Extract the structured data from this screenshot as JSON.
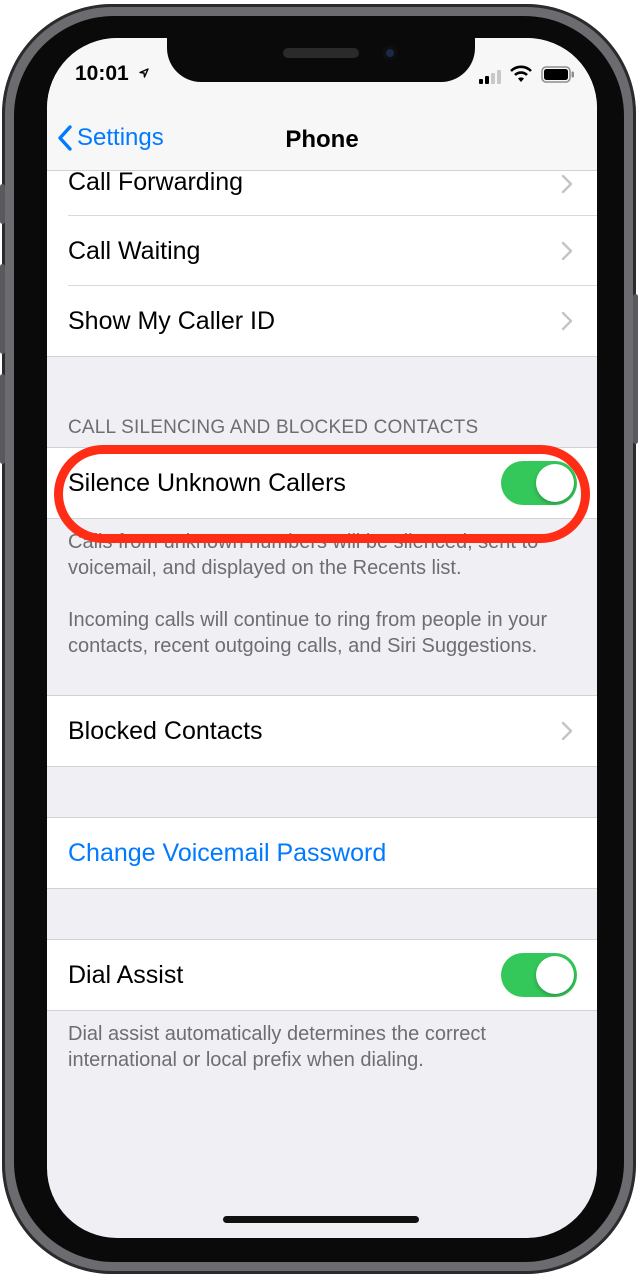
{
  "status_bar": {
    "time": "10:01",
    "icons": [
      "location-arrow-icon",
      "cellular-signal-icon",
      "wifi-icon",
      "battery-icon"
    ]
  },
  "nav": {
    "back_label": "Settings",
    "title": "Phone"
  },
  "cells_top": [
    {
      "label": "Call Forwarding",
      "accessory": "chevron"
    },
    {
      "label": "Call Waiting",
      "accessory": "chevron"
    },
    {
      "label": "Show My Caller ID",
      "accessory": "chevron"
    }
  ],
  "silencing_section": {
    "header": "CALL SILENCING AND BLOCKED CONTACTS",
    "silence_label": "Silence Unknown Callers",
    "silence_on": true,
    "footer_1": "Calls from unknown numbers will be silenced, sent to voicemail, and displayed on the Recents list.",
    "footer_2": "Incoming calls will continue to ring from people in your contacts, recent outgoing calls, and Siri Suggestions."
  },
  "blocked": {
    "label": "Blocked Contacts"
  },
  "voicemail": {
    "label": "Change Voicemail Password"
  },
  "dial_assist": {
    "label": "Dial Assist",
    "on": true,
    "footer": "Dial assist automatically determines the correct international or local prefix when dialing."
  },
  "colors": {
    "accent": "#007aff",
    "toggle_on": "#34c759",
    "highlight": "#ff2d16",
    "background": "#efeff4"
  }
}
